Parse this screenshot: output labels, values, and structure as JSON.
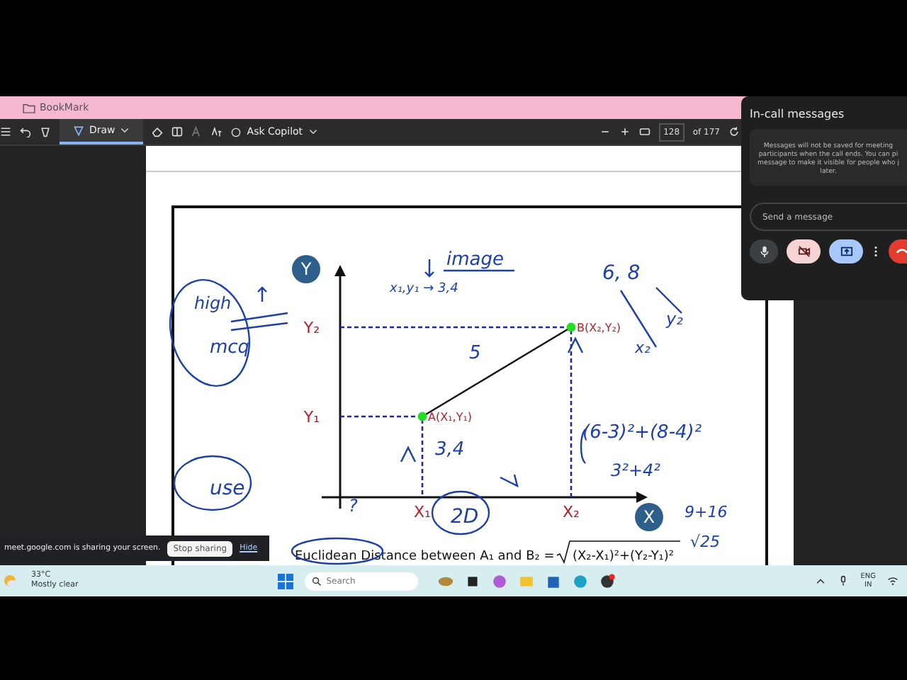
{
  "browser": {
    "bookmark": "BookMark"
  },
  "toolbar": {
    "tools": [
      {
        "kind": "draw",
        "label": "Draw",
        "selected": true
      }
    ],
    "copilot": "Ask Copilot",
    "page_number": "128",
    "page_total": "of 177"
  },
  "diagram": {
    "axis_badges": [
      "Y",
      "X"
    ],
    "y_ticks": [
      "Y₂",
      "Y₁"
    ],
    "x_ticks": [
      "X₁",
      "X₂"
    ],
    "points": [
      {
        "label": "A(X₁,Y₁)"
      },
      {
        "label": "B(X₂,Y₂)"
      }
    ],
    "formula": "Euclidean Distance between A₁ and B₂ =",
    "formula_root": "(X₂-X₁)²+(Y₂-Y₁)²"
  },
  "ink_notes": [
    "image",
    "x₁,y₁ → 3,4",
    "6, 8",
    "y₂",
    "5",
    "x₂",
    "high",
    "mcq",
    "3,4",
    "(6-3)²+(8-4)²",
    "3²+4²",
    "9+16",
    "√25",
    "use",
    "2D",
    "?"
  ],
  "meet_panel": {
    "title": "In-call messages",
    "info_lines": [
      "Messages will not be saved for meeting",
      "participants when the call ends. You can pi",
      "message to make it visible for people who j",
      "later."
    ],
    "placeholder": "Send a message",
    "controls": [
      {
        "kind": "mic"
      },
      {
        "kind": "camera",
        "on": false
      },
      {
        "kind": "present"
      },
      {
        "kind": "more"
      },
      {
        "kind": "end"
      }
    ]
  },
  "share_bar": {
    "message": "meet.google.com is sharing your screen.",
    "stop": "Stop sharing",
    "hide": "Hide"
  },
  "taskbar": {
    "temperature": "33°C",
    "weather": "Mostly clear",
    "search_placeholder": "Search",
    "language": "ENG",
    "region": "IN"
  }
}
